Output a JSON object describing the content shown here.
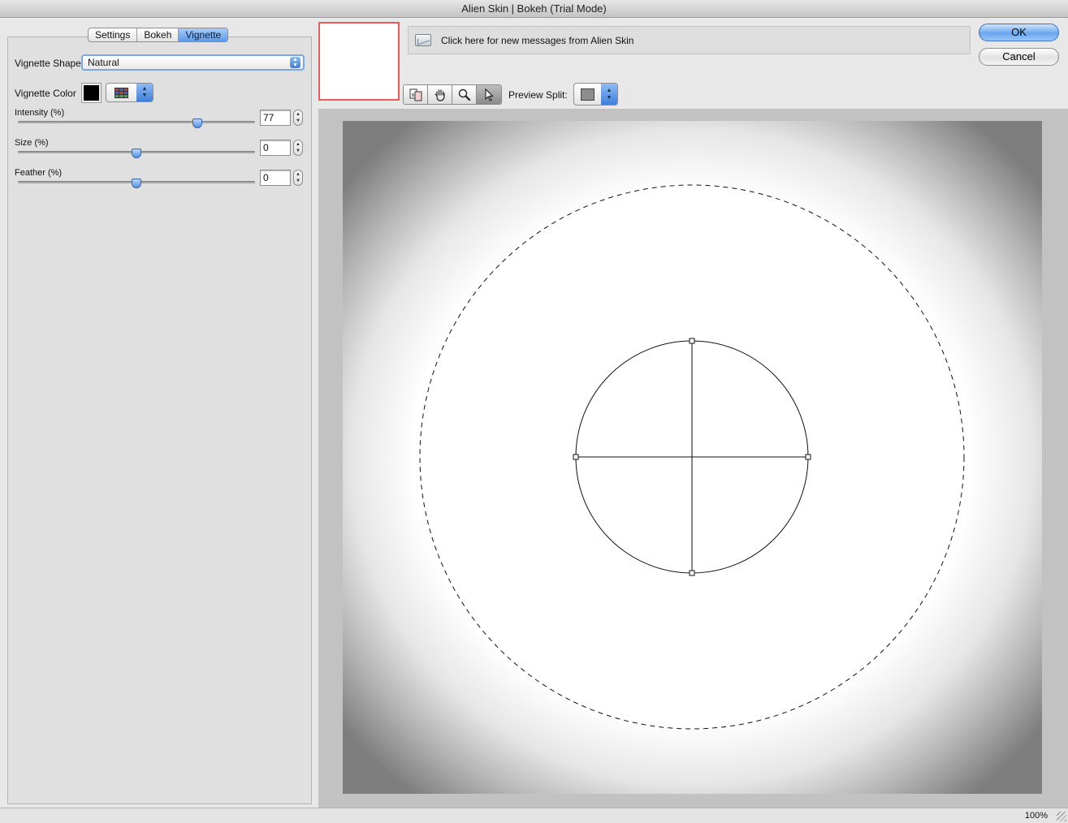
{
  "window": {
    "title": "Alien Skin | Bokeh (Trial Mode)"
  },
  "tabs": [
    {
      "label": "Settings",
      "active": false
    },
    {
      "label": "Bokeh",
      "active": false
    },
    {
      "label": "Vignette",
      "active": true
    }
  ],
  "vignette": {
    "shape_label": "Vignette Shape",
    "shape_value": "Natural",
    "color_label": "Vignette Color",
    "color_value": "#000000",
    "sliders": [
      {
        "label": "Intensity (%)",
        "value": "77"
      },
      {
        "label": "Size (%)",
        "value": "0"
      },
      {
        "label": "Feather (%)",
        "value": "0"
      }
    ]
  },
  "messages": {
    "text": "Click here for new messages from Alien Skin"
  },
  "buttons": {
    "ok": "OK",
    "cancel": "Cancel"
  },
  "toolbar": {
    "tools": [
      "compare-icon",
      "hand-icon",
      "zoom-icon",
      "arrow-pointer-icon"
    ],
    "active_tool": "arrow-pointer-icon",
    "preview_split_label": "Preview Split:"
  },
  "status": {
    "zoom": "100%"
  },
  "colors": {
    "accent": "#5b9ae8",
    "thumbnail_border": "#e85c5c"
  }
}
